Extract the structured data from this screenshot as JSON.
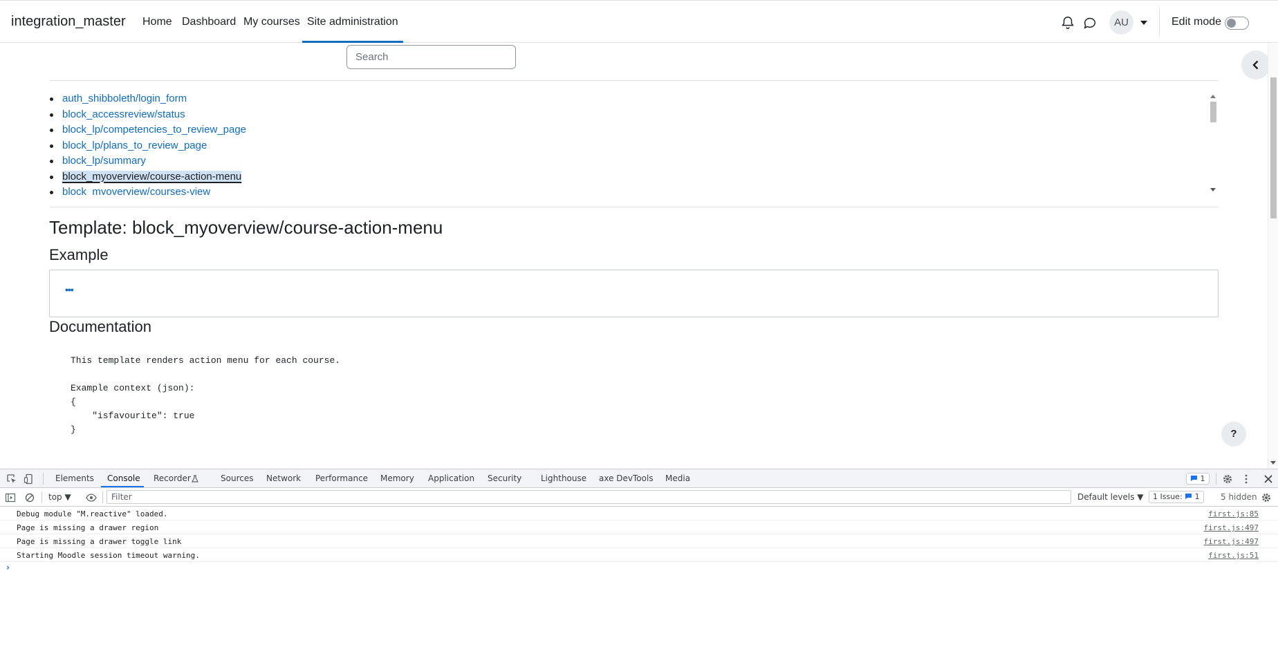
{
  "navbar": {
    "brand": "integration_master",
    "items": [
      {
        "label": "Home"
      },
      {
        "label": "Dashboard"
      },
      {
        "label": "My courses"
      },
      {
        "label": "Site administration"
      }
    ],
    "avatar_initials": "AU",
    "edit_mode_label": "Edit mode"
  },
  "search": {
    "placeholder": "Search"
  },
  "template_list": [
    "auth_shibboleth/login_form",
    "block_accessreview/status",
    "block_lp/competencies_to_review_page",
    "block_lp/plans_to_review_page",
    "block_lp/summary",
    "block_myoverview/course-action-menu",
    "block_myoverview/courses-view"
  ],
  "main": {
    "template_heading": "Template: block_myoverview/course-action-menu",
    "example_heading": "Example",
    "documentation_heading": "Documentation",
    "documentation_text": "This template renders action menu for each course.\n\nExample context (json):\n{\n    \"isfavourite\": true\n}",
    "more_button_glyph": "•••",
    "help_button_glyph": "?"
  },
  "devtools": {
    "tabs": [
      "Elements",
      "Console",
      "Recorder",
      "Sources",
      "Network",
      "Performance",
      "Memory",
      "Application",
      "Security",
      "Lighthouse",
      "axe DevTools",
      "Media"
    ],
    "issue_badge": "1",
    "context": "top ▼",
    "filter_placeholder": "Filter",
    "levels": "Default levels ▼",
    "issues_label": "1 Issue:",
    "issues_count": "1",
    "hidden_count": "5 hidden",
    "messages": [
      {
        "text": "Debug module \"M.reactive\" loaded.",
        "source": "first.js:85"
      },
      {
        "text": "Page is missing a drawer region",
        "source": "first.js:497"
      },
      {
        "text": "Page is missing a drawer toggle link",
        "source": "first.js:497"
      },
      {
        "text": "Starting Moodle session timeout warning.",
        "source": "first.js:51"
      }
    ],
    "prompt": "›"
  },
  "colors": {
    "accent": "#0f6cbf",
    "devtools_accent": "#1a73e8"
  }
}
